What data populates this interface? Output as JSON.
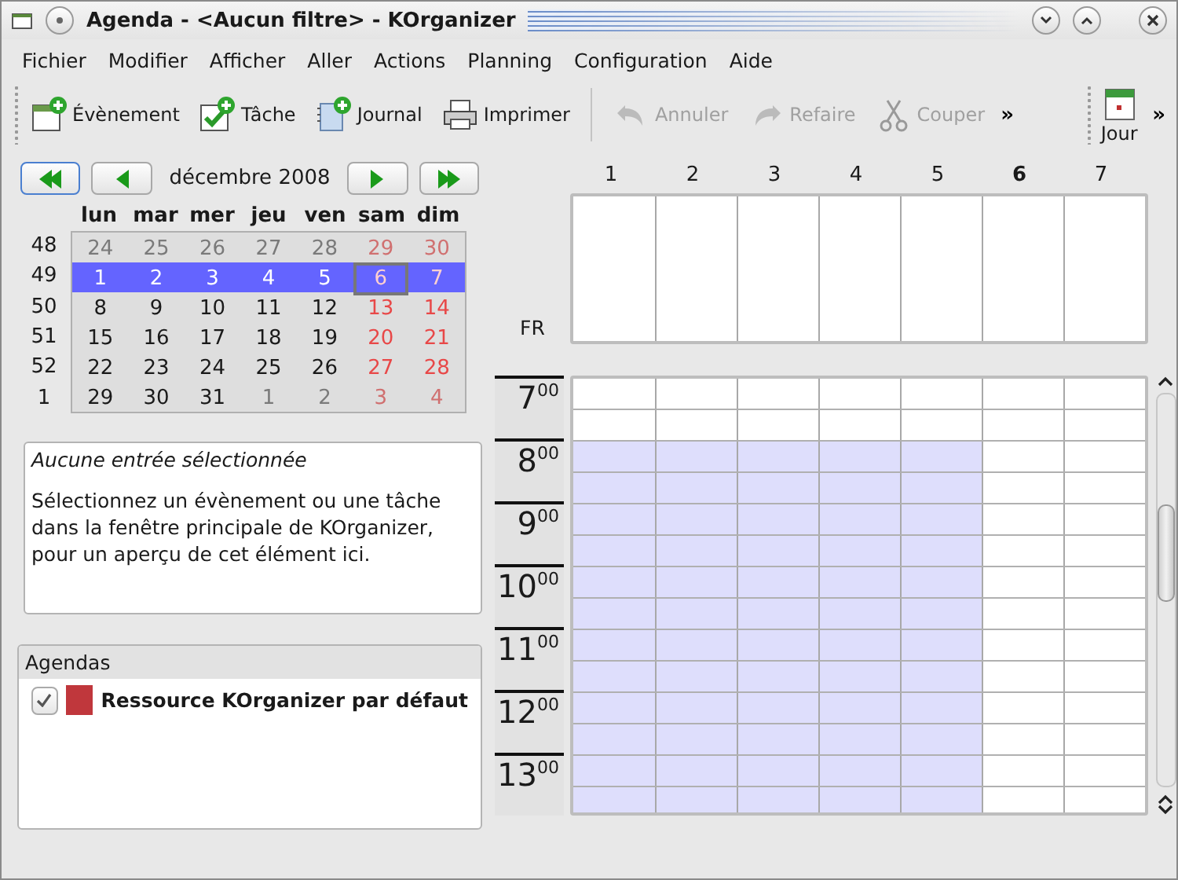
{
  "window": {
    "title": "Agenda - <Aucun filtre>  - KOrganizer"
  },
  "menu": [
    {
      "label": "Fichier"
    },
    {
      "label": "Modifier"
    },
    {
      "label": "Afficher"
    },
    {
      "label": "Aller"
    },
    {
      "label": "Actions"
    },
    {
      "label": "Planning"
    },
    {
      "label": "Configuration"
    },
    {
      "label": "Aide"
    }
  ],
  "toolbar": {
    "items": [
      {
        "kind": "button",
        "label": "Évènement",
        "disabled": false
      },
      {
        "kind": "button",
        "label": "Tâche",
        "disabled": false
      },
      {
        "kind": "button",
        "label": "Journal",
        "disabled": false
      },
      {
        "kind": "button",
        "label": "Imprimer",
        "disabled": false
      },
      {
        "kind": "separator"
      },
      {
        "kind": "button",
        "label": "Annuler",
        "disabled": true
      },
      {
        "kind": "button",
        "label": "Refaire",
        "disabled": true
      },
      {
        "kind": "button",
        "label": "Couper",
        "disabled": true
      },
      {
        "kind": "overflow",
        "label": "»"
      }
    ],
    "view_items": [
      {
        "kind": "button",
        "label": "Jour",
        "disabled": false
      },
      {
        "kind": "overflow",
        "label": "»"
      }
    ]
  },
  "navigator": {
    "month": "décembre 2008",
    "weekdays": [
      "lun",
      "mar",
      "mer",
      "jeu",
      "ven",
      "sam",
      "dim"
    ],
    "weeks": [
      {
        "number": "48",
        "selected": false,
        "days": [
          {
            "label": "24",
            "other_month": true,
            "weekend": false,
            "today": false
          },
          {
            "label": "25",
            "other_month": true,
            "weekend": false,
            "today": false
          },
          {
            "label": "26",
            "other_month": true,
            "weekend": false,
            "today": false
          },
          {
            "label": "27",
            "other_month": true,
            "weekend": false,
            "today": false
          },
          {
            "label": "28",
            "other_month": true,
            "weekend": false,
            "today": false
          },
          {
            "label": "29",
            "other_month": true,
            "weekend": true,
            "today": false
          },
          {
            "label": "30",
            "other_month": true,
            "weekend": true,
            "today": false
          }
        ]
      },
      {
        "number": "49",
        "selected": true,
        "days": [
          {
            "label": "1",
            "other_month": false,
            "weekend": false,
            "today": false
          },
          {
            "label": "2",
            "other_month": false,
            "weekend": false,
            "today": false
          },
          {
            "label": "3",
            "other_month": false,
            "weekend": false,
            "today": false
          },
          {
            "label": "4",
            "other_month": false,
            "weekend": false,
            "today": false
          },
          {
            "label": "5",
            "other_month": false,
            "weekend": false,
            "today": false
          },
          {
            "label": "6",
            "other_month": false,
            "weekend": true,
            "today": true
          },
          {
            "label": "7",
            "other_month": false,
            "weekend": true,
            "today": false
          }
        ]
      },
      {
        "number": "50",
        "selected": false,
        "days": [
          {
            "label": "8",
            "other_month": false,
            "weekend": false,
            "today": false
          },
          {
            "label": "9",
            "other_month": false,
            "weekend": false,
            "today": false
          },
          {
            "label": "10",
            "other_month": false,
            "weekend": false,
            "today": false
          },
          {
            "label": "11",
            "other_month": false,
            "weekend": false,
            "today": false
          },
          {
            "label": "12",
            "other_month": false,
            "weekend": false,
            "today": false
          },
          {
            "label": "13",
            "other_month": false,
            "weekend": true,
            "today": false
          },
          {
            "label": "14",
            "other_month": false,
            "weekend": true,
            "today": false
          }
        ]
      },
      {
        "number": "51",
        "selected": false,
        "days": [
          {
            "label": "15",
            "other_month": false,
            "weekend": false,
            "today": false
          },
          {
            "label": "16",
            "other_month": false,
            "weekend": false,
            "today": false
          },
          {
            "label": "17",
            "other_month": false,
            "weekend": false,
            "today": false
          },
          {
            "label": "18",
            "other_month": false,
            "weekend": false,
            "today": false
          },
          {
            "label": "19",
            "other_month": false,
            "weekend": false,
            "today": false
          },
          {
            "label": "20",
            "other_month": false,
            "weekend": true,
            "today": false
          },
          {
            "label": "21",
            "other_month": false,
            "weekend": true,
            "today": false
          }
        ]
      },
      {
        "number": "52",
        "selected": false,
        "days": [
          {
            "label": "22",
            "other_month": false,
            "weekend": false,
            "today": false
          },
          {
            "label": "23",
            "other_month": false,
            "weekend": false,
            "today": false
          },
          {
            "label": "24",
            "other_month": false,
            "weekend": false,
            "today": false
          },
          {
            "label": "25",
            "other_month": false,
            "weekend": false,
            "today": false
          },
          {
            "label": "26",
            "other_month": false,
            "weekend": false,
            "today": false
          },
          {
            "label": "27",
            "other_month": false,
            "weekend": true,
            "today": false
          },
          {
            "label": "28",
            "other_month": false,
            "weekend": true,
            "today": false
          }
        ]
      },
      {
        "number": "1",
        "selected": false,
        "days": [
          {
            "label": "29",
            "other_month": false,
            "weekend": false,
            "today": false
          },
          {
            "label": "30",
            "other_month": false,
            "weekend": false,
            "today": false
          },
          {
            "label": "31",
            "other_month": false,
            "weekend": false,
            "today": false
          },
          {
            "label": "1",
            "other_month": true,
            "weekend": false,
            "today": false
          },
          {
            "label": "2",
            "other_month": true,
            "weekend": false,
            "today": false
          },
          {
            "label": "3",
            "other_month": true,
            "weekend": true,
            "today": false
          },
          {
            "label": "4",
            "other_month": true,
            "weekend": true,
            "today": false
          }
        ]
      }
    ]
  },
  "preview": {
    "title": "Aucune entrée sélectionnée",
    "body": "Sélectionnez un évènement ou une tâche dans la fenêtre principale de KOrganizer, pour un aperçu de cet élément ici."
  },
  "calendars": {
    "header": "Agendas",
    "items": [
      {
        "label": "Ressource KOrganizer par défaut",
        "checked": true,
        "color": "#c0373c"
      }
    ]
  },
  "agenda": {
    "timezone": "FR",
    "days": [
      {
        "label": "1",
        "today": false,
        "working": true
      },
      {
        "label": "2",
        "today": false,
        "working": true
      },
      {
        "label": "3",
        "today": false,
        "working": true
      },
      {
        "label": "4",
        "today": false,
        "working": true
      },
      {
        "label": "5",
        "today": false,
        "working": true
      },
      {
        "label": "6",
        "today": true,
        "working": false
      },
      {
        "label": "7",
        "today": false,
        "working": false
      }
    ],
    "hours": [
      {
        "label": "7$^{00}$",
        "working": false
      },
      {
        "label": "8$^{00}$",
        "working": true
      },
      {
        "label": "9$^{00}$",
        "working": true
      },
      {
        "label": "10$^{00}$",
        "working": true
      },
      {
        "label": "11$^{00}$",
        "working": true
      },
      {
        "label": "12$^{00}$",
        "working": true
      },
      {
        "label": "13$^{00}$",
        "working": true
      }
    ]
  }
}
